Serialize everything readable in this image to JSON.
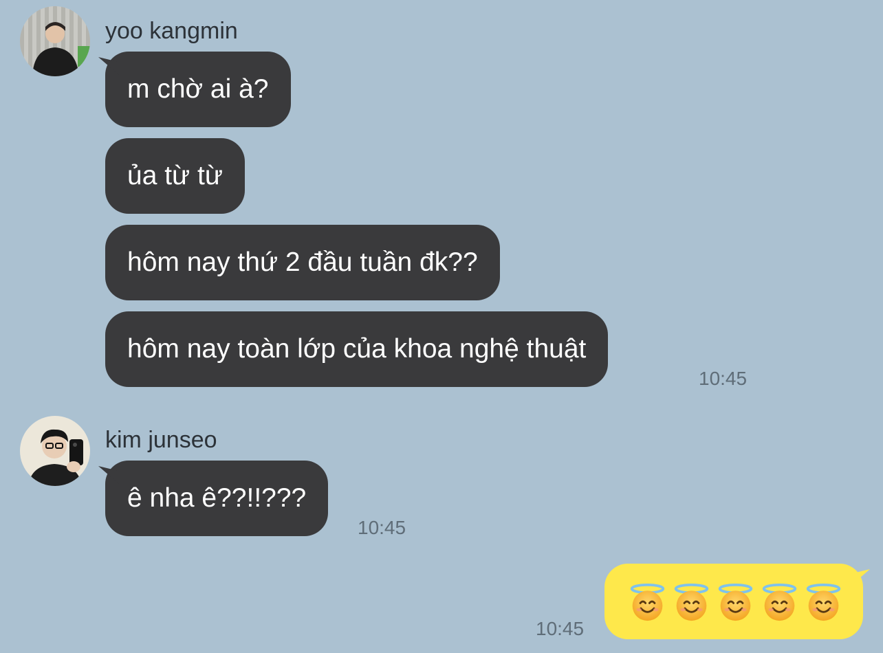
{
  "messages": [
    {
      "sender": "yoo kangmin",
      "avatar_icon": "user-photo-icon",
      "bubbles": [
        "m chờ ai à?",
        "ủa từ từ",
        "hôm nay thứ 2 đầu tuần đk??",
        "hôm nay toàn lớp của khoa nghệ thuật"
      ],
      "time": "10:45"
    },
    {
      "sender": "kim junseo",
      "avatar_icon": "user-photo-icon",
      "bubbles": [
        "ê nha ê??!!???"
      ],
      "time": "10:45"
    }
  ],
  "my_message": {
    "emoji": "😇😇😇😇😇",
    "emoji_icon": "smiling-face-with-halo-icon",
    "time": "10:45"
  },
  "colors": {
    "background": "#abc1d1",
    "incoming_bubble": "#3a3a3c",
    "outgoing_bubble": "#fee84b"
  }
}
